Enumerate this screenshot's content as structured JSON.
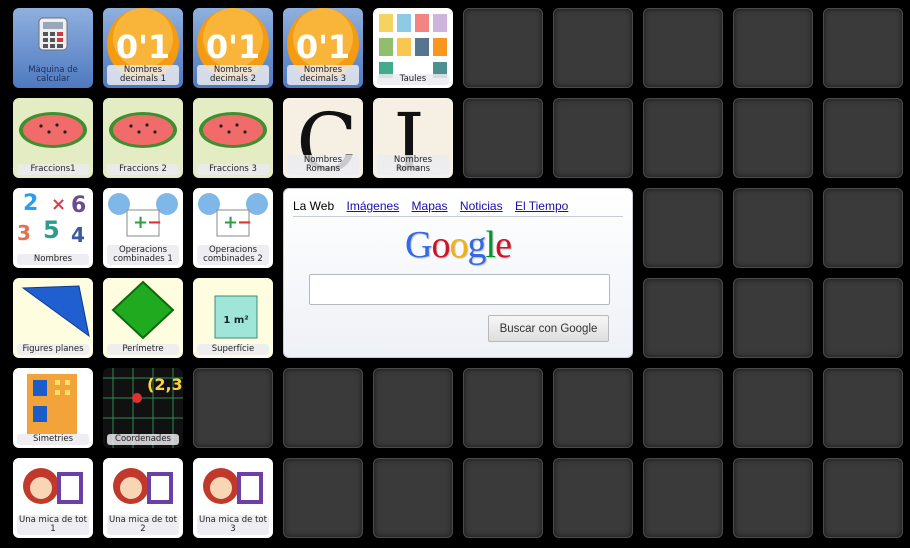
{
  "tiles": [
    {
      "label": "Màquina de\ncalcular",
      "icon": "calculator-icon"
    },
    {
      "label": "Nombres\ndecimals 1",
      "icon": "decimal-icon",
      "glyph": "0'1"
    },
    {
      "label": "Nombres\ndecimals 2",
      "icon": "decimal-icon",
      "glyph": "0'1"
    },
    {
      "label": "Nombres\ndecimals 3",
      "icon": "decimal-icon",
      "glyph": "0'1"
    },
    {
      "label": "Taules",
      "icon": "times-tables-icon"
    },
    {
      "label": "Fraccions1",
      "icon": "watermelon-icon"
    },
    {
      "label": "Fraccions 2",
      "icon": "watermelon-icon"
    },
    {
      "label": "Fraccions 3",
      "icon": "watermelon-icon"
    },
    {
      "label": "Nombres\nRomans",
      "icon": "roman-numeral-icon",
      "glyph": "C"
    },
    {
      "label": "Nombres\nRomans",
      "icon": "roman-numeral-icon",
      "glyph": "I"
    },
    {
      "label": "Nombres",
      "icon": "numbers-icon",
      "digits": [
        "2",
        "×",
        "6",
        "3",
        "5",
        "4"
      ]
    },
    {
      "label": "Operacions\ncombinades 1",
      "icon": "kids-operations-icon"
    },
    {
      "label": "Operacions\ncombinades 2",
      "icon": "kids-operations-icon"
    },
    {
      "label": "Figures planes",
      "icon": "triangle-shape-icon"
    },
    {
      "label": "Perímetre",
      "icon": "green-diamond-icon"
    },
    {
      "label": "Superfície",
      "icon": "square-meter-icon",
      "glyph": "1 m²"
    },
    {
      "label": "Simetries",
      "icon": "symmetry-icon"
    },
    {
      "label": "Coordenades",
      "icon": "coordinates-grid-icon",
      "glyph": "(2,3"
    },
    {
      "label": "Una mica de tot\n1",
      "icon": "cartoon-girl-icon"
    },
    {
      "label": "Una mica de tot\n2",
      "icon": "cartoon-girl-icon"
    },
    {
      "label": "Una mica de tot\n3",
      "icon": "cartoon-girl-icon"
    }
  ],
  "google": {
    "tabs": [
      "La Web",
      "Imágenes",
      "Mapas",
      "Noticias",
      "El Tiempo"
    ],
    "logo": "Google",
    "search_placeholder": "",
    "search_button": "Buscar con Google"
  },
  "colors": {
    "background": "#000000",
    "empty_tile": "#3a3a3a",
    "decimal_orange": "#f59b12",
    "watermelon_red": "#f26b6b",
    "google_blue": "#3369e8",
    "google_red": "#d50f25",
    "google_yellow": "#eeb211",
    "google_green": "#009925"
  }
}
